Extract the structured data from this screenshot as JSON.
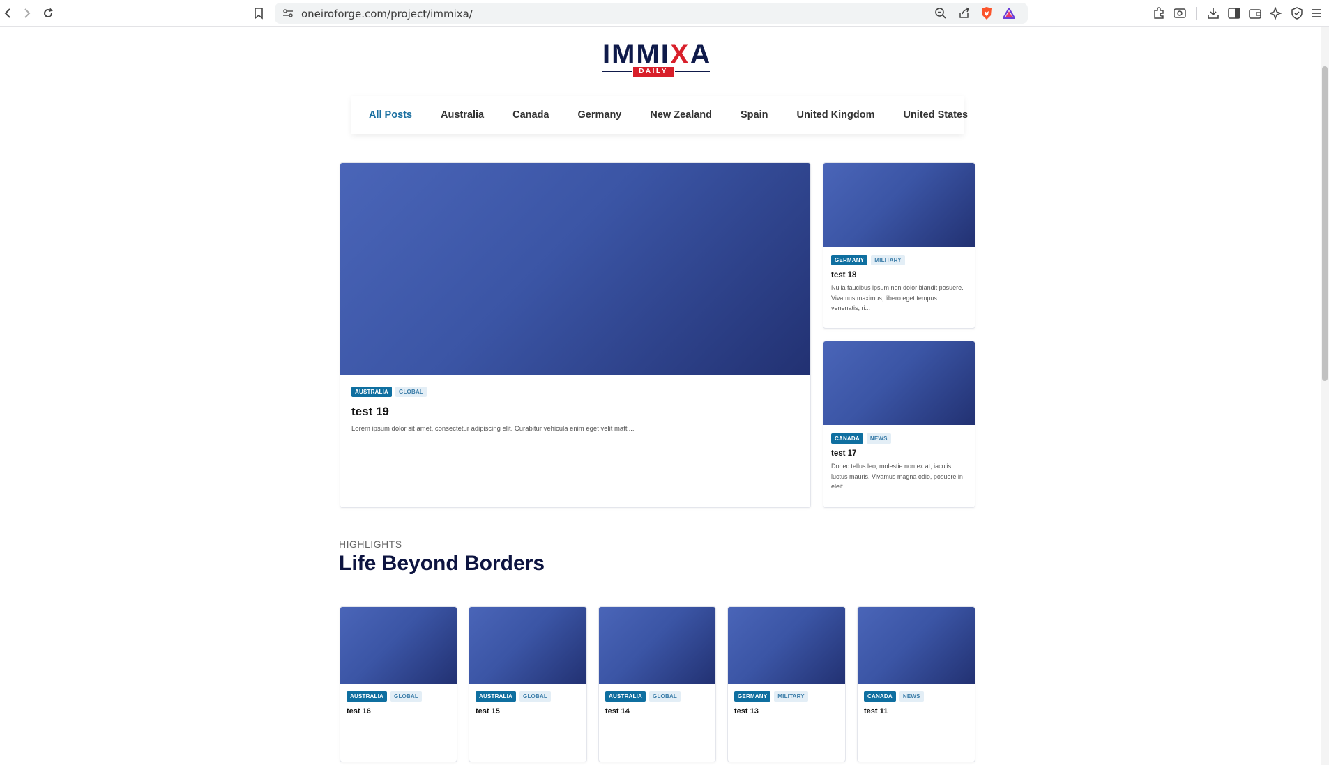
{
  "browser": {
    "url": "oneiroforge.com/project/immixa/"
  },
  "logo": {
    "word_part1": "IMMI",
    "word_x": "X",
    "word_part2": "A",
    "tagline": "DAILY"
  },
  "nav": {
    "items": [
      "All Posts",
      "Australia",
      "Canada",
      "Germany",
      "New Zealand",
      "Spain",
      "United Kingdom",
      "United States"
    ],
    "active": "All Posts"
  },
  "featured": {
    "main": {
      "country": "AUSTRALIA",
      "category": "GLOBAL",
      "title": "test 19",
      "excerpt": "Lorem ipsum dolor sit amet, consectetur adipiscing elit. Curabitur vehicula enim eget velit matti..."
    },
    "side": [
      {
        "country": "GERMANY",
        "category": "MILITARY",
        "title": "test 18",
        "excerpt": "Nulla faucibus ipsum non dolor blandit posuere. Vivamus maximus, libero eget tempus venenatis, ri..."
      },
      {
        "country": "CANADA",
        "category": "NEWS",
        "title": "test 17",
        "excerpt": "Donec tellus leo, molestie non ex at, iaculis luctus mauris. Vivamus magna odio, posuere in eleif..."
      }
    ]
  },
  "highlights": {
    "kicker": "HIGHLIGHTS",
    "title": "Life Beyond Borders",
    "cards": [
      {
        "country": "AUSTRALIA",
        "category": "GLOBAL",
        "title": "test 16"
      },
      {
        "country": "AUSTRALIA",
        "category": "GLOBAL",
        "title": "test 15"
      },
      {
        "country": "AUSTRALIA",
        "category": "GLOBAL",
        "title": "test 14"
      },
      {
        "country": "GERMANY",
        "category": "MILITARY",
        "title": "test 13"
      },
      {
        "country": "CANADA",
        "category": "NEWS",
        "title": "test 11"
      }
    ]
  },
  "colors": {
    "accent": "#1a6fa0",
    "brand_navy": "#0f1a4a",
    "brand_red": "#d81f2a",
    "thumb_gradient_start": "#4a65b8",
    "thumb_gradient_end": "#223172"
  }
}
